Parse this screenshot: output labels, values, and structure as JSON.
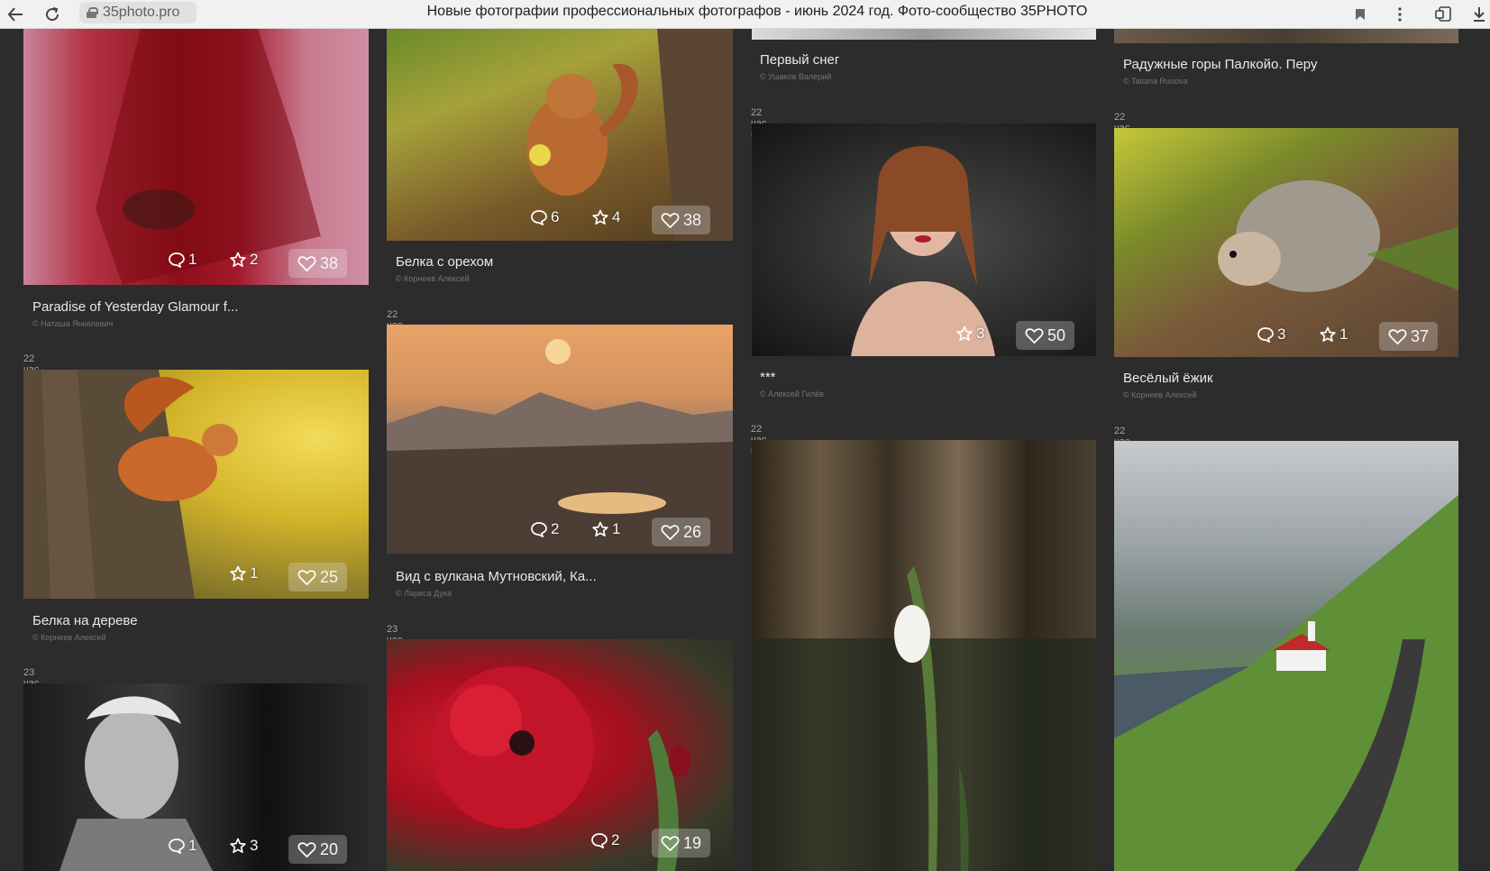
{
  "browser": {
    "url": "35photo.pro",
    "page_title": "Новые фотографии профессиональных фотографов - июнь 2024 год. Фото-сообщество 35PHOTO",
    "icons": [
      "back-arrow-icon",
      "reload-icon",
      "lock-icon",
      "bookmark-icon",
      "menu-dots-icon",
      "extensions-icon",
      "download-icon"
    ]
  },
  "cards": [
    {
      "id": "c1",
      "time": "",
      "title": "Paradise of Yesterday Glamour f...",
      "author": "© Наташа Янкелевич",
      "comments": "1",
      "stars": "2",
      "likes": "38"
    },
    {
      "id": "c2",
      "time": "",
      "title": "Белка с орехом",
      "author": "© Корнеев Алексей",
      "comments": "6",
      "stars": "4",
      "likes": "38"
    },
    {
      "id": "c3",
      "time": "",
      "title": "Первый снег",
      "author": "© Ушаков Валерий",
      "comments": "",
      "stars": "",
      "likes": ""
    },
    {
      "id": "c4",
      "time": "",
      "title": "Радужные горы Палкойо. Перу",
      "author": "© Tatiana Runova",
      "comments": "",
      "stars": "",
      "likes": ""
    },
    {
      "id": "c5",
      "time": "22 час. назад",
      "title": "***",
      "author": "© Алексей Гилёв",
      "comments": "",
      "stars": "3",
      "likes": "50"
    },
    {
      "id": "c6",
      "time": "22 час. назад",
      "title": "Весёлый ёжик",
      "author": "© Корнеев Алексей",
      "comments": "3",
      "stars": "1",
      "likes": "37"
    },
    {
      "id": "c7",
      "time": "22 час. назад",
      "title": "Вид с вулкана Мутновский, Ка...",
      "author": "© Лариса Дука",
      "comments": "2",
      "stars": "1",
      "likes": "26"
    },
    {
      "id": "c8",
      "time": "22 час. назад",
      "title": "Белка на дереве",
      "author": "© Корнеев Алексей",
      "comments": "",
      "stars": "1",
      "likes": "25"
    },
    {
      "id": "c9",
      "time": "22 час. назад",
      "title": "",
      "author": "",
      "comments": "",
      "stars": "",
      "likes": ""
    },
    {
      "id": "c10",
      "time": "22 час. назад",
      "title": "",
      "author": "",
      "comments": "",
      "stars": "",
      "likes": ""
    },
    {
      "id": "c11",
      "time": "23 час. назад",
      "title": "",
      "author": "",
      "comments": "2",
      "stars": "",
      "likes": "19"
    },
    {
      "id": "c12",
      "time": "23 час. назад",
      "title": "",
      "author": "",
      "comments": "1",
      "stars": "3",
      "likes": "20"
    }
  ],
  "colors": {
    "page_bg": "#2c2c2c",
    "title_text": "#e9e9e9",
    "meta_text": "#747474"
  }
}
